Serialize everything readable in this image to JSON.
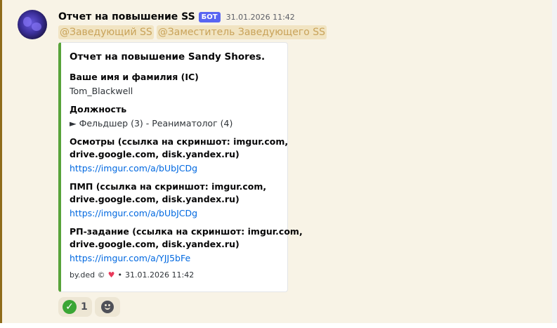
{
  "message": {
    "username": "Отчет на повышение SS",
    "bot_tag": "БОТ",
    "timestamp": "31.01.2026 11:42",
    "mentions": [
      "@Заведующий SS",
      "@Заместитель Заведующего SS"
    ]
  },
  "embed": {
    "accent_color": "#58a33a",
    "title": "Отчет на повышение Sandy Shores.",
    "fields": [
      {
        "name": "Ваше имя и фамилия (IC)",
        "value": "Tom_Blackwell"
      },
      {
        "name": "Должность",
        "value": "► Фельдшер (3) - Реаниматолог (4)"
      },
      {
        "name_lines": [
          "Осмотры (ссылка на скриншот: imgur.com,",
          "drive.google.com, disk.yandex.ru)"
        ],
        "link": "https://imgur.com/a/bUbJCDg"
      },
      {
        "name_lines": [
          "ПМП (ссылка на скриншот: imgur.com,",
          "drive.google.com, disk.yandex.ru)"
        ],
        "link": "https://imgur.com/a/bUbJCDg"
      },
      {
        "name_lines": [
          "РП-задание   (ссылка на скриншот: imgur.com,",
          "drive.google.com, disk.yandex.ru)"
        ],
        "link": "https://imgur.com/a/YJJ5bFe"
      }
    ],
    "footer": {
      "text": "by.ded ©",
      "icon": "heart-icon",
      "separator": "•",
      "timestamp": "31.01.2026 11:42"
    }
  },
  "reactions": [
    {
      "icon": "check-mark-icon",
      "count": "1"
    }
  ],
  "colors": {
    "bot_tag": "#5865f2",
    "mention_text": "#c9a35a",
    "link": "#0068e0",
    "message_highlight": "#f8f3e6"
  }
}
